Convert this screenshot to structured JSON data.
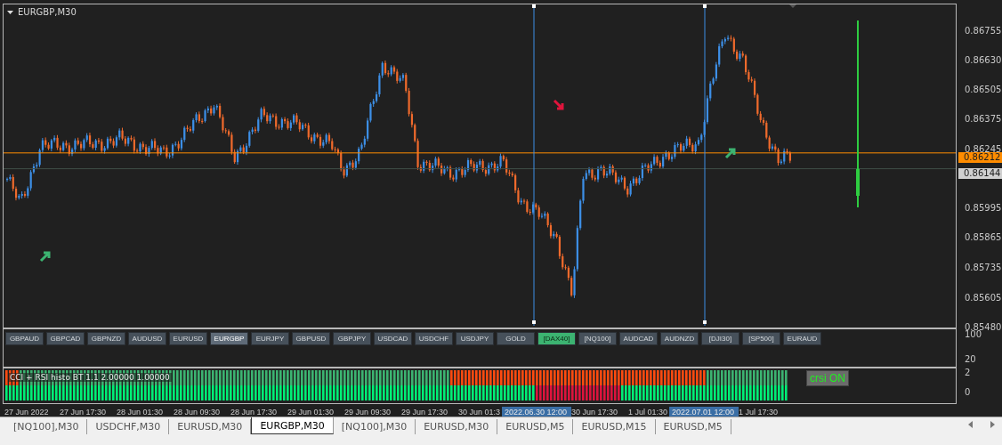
{
  "chart": {
    "title": "EURGBP,M30",
    "price_axis": [
      "0.86755",
      "0.86630",
      "0.86505",
      "0.86375",
      "0.86245",
      "0.85995",
      "0.85865",
      "0.85735",
      "0.85605",
      "0.85480"
    ],
    "price_tags": [
      {
        "kind": "bid",
        "text": "0.86212"
      },
      {
        "kind": "level",
        "text": "0.86144"
      }
    ]
  },
  "symbol_buttons": [
    {
      "label": "GBPAUD",
      "selected": false,
      "active": false
    },
    {
      "label": "GBPCAD",
      "selected": false,
      "active": false
    },
    {
      "label": "GBPNZD",
      "selected": false,
      "active": false
    },
    {
      "label": "AUDUSD",
      "selected": false,
      "active": false
    },
    {
      "label": "EURUSD",
      "selected": false,
      "active": false
    },
    {
      "label": "EURGBP",
      "selected": true,
      "active": false
    },
    {
      "label": "EURJPY",
      "selected": false,
      "active": false
    },
    {
      "label": "GBPUSD",
      "selected": false,
      "active": false
    },
    {
      "label": "GBPJPY",
      "selected": false,
      "active": false
    },
    {
      "label": "USDCAD",
      "selected": false,
      "active": false
    },
    {
      "label": "USDCHF",
      "selected": false,
      "active": false
    },
    {
      "label": "USDJPY",
      "selected": false,
      "active": false
    },
    {
      "label": "GOLD",
      "selected": false,
      "active": false
    },
    {
      "label": "[DAX40]",
      "selected": false,
      "active": true
    },
    {
      "label": "[NQ100]",
      "selected": false,
      "active": false
    },
    {
      "label": "AUDCAD",
      "selected": false,
      "active": false
    },
    {
      "label": "AUDNZD",
      "selected": false,
      "active": false
    },
    {
      "label": "[DJI30]",
      "selected": false,
      "active": false
    },
    {
      "label": "[SP500]",
      "selected": false,
      "active": false
    },
    {
      "label": "EURAUD",
      "selected": false,
      "active": false
    }
  ],
  "button_pane_axis": [
    "100",
    "20"
  ],
  "indicator": {
    "label": "CCI + RSI histo BT 1.1 2.00000 1.00000",
    "toggle": "crsi ON",
    "axis": [
      "2",
      "0"
    ]
  },
  "time_axis": [
    {
      "kind": "tick",
      "text": "27 Jun 2022"
    },
    {
      "kind": "tick",
      "text": "27 Jun 17:30"
    },
    {
      "kind": "tick",
      "text": "28 Jun 01:30"
    },
    {
      "kind": "tick",
      "text": "28 Jun 09:30"
    },
    {
      "kind": "tick",
      "text": "28 Jun 17:30"
    },
    {
      "kind": "tick",
      "text": "29 Jun 01:30"
    },
    {
      "kind": "tick",
      "text": "29 Jun 09:30"
    },
    {
      "kind": "tick",
      "text": "29 Jun 17:30"
    },
    {
      "kind": "tick",
      "text": "30 Jun 01:3"
    },
    {
      "kind": "cursor",
      "text": "2022.06.30 12:00"
    },
    {
      "kind": "tick",
      "text": "30 Jun 17:30"
    },
    {
      "kind": "tick",
      "text": "1 Jul 01:30"
    },
    {
      "kind": "cursor",
      "text": "2022.07.01 12:00"
    },
    {
      "kind": "tick",
      "text": "1 Jul 17:30"
    }
  ],
  "tabs": [
    {
      "label": "[NQ100],M30",
      "selected": false
    },
    {
      "label": "USDCHF,M30",
      "selected": false
    },
    {
      "label": "EURUSD,M30",
      "selected": false
    },
    {
      "label": "EURGBP,M30",
      "selected": true
    },
    {
      "label": "[NQ100],M30",
      "selected": false
    },
    {
      "label": "EURUSD,M30",
      "selected": false
    },
    {
      "label": "EURUSD,M5",
      "selected": false
    },
    {
      "label": "EURUSD,M15",
      "selected": false
    },
    {
      "label": "EURUSD,M5",
      "selected": false
    }
  ]
}
